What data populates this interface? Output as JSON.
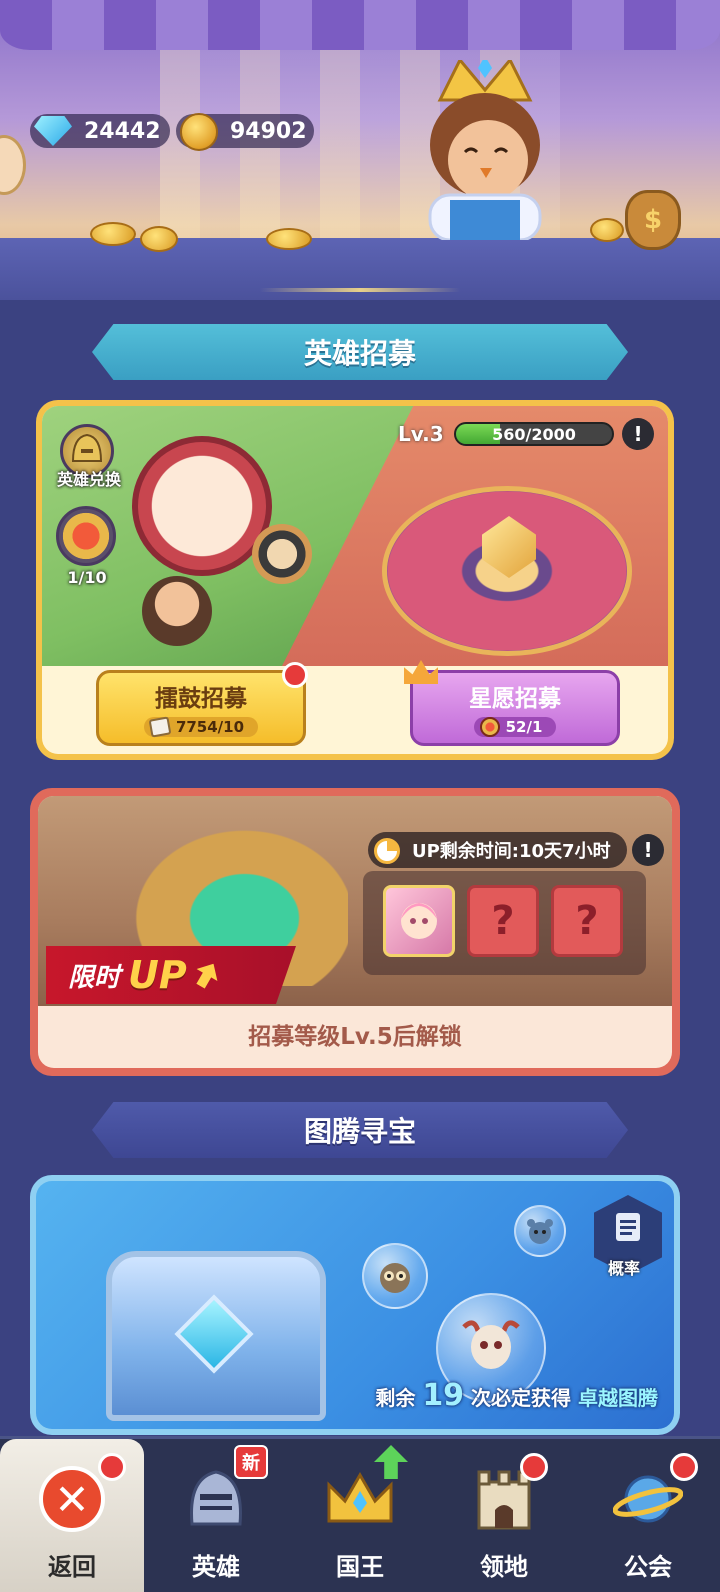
{
  "currency": {
    "gems": "24442",
    "gold": "94902"
  },
  "recruit": {
    "section_title": "英雄招募",
    "hero_exchange_label": "英雄兑换",
    "token_count": "1/10",
    "level_label": "Lv.3",
    "exp_text": "560/2000",
    "exp_progress": 0.28,
    "info_icon": "!",
    "drum_button": {
      "title": "擂鼓招募",
      "cost": "7754/10"
    },
    "star_button": {
      "title": "星愿招募",
      "cost": "52/1"
    }
  },
  "limited_up": {
    "ribbon_prefix": "限时",
    "ribbon_up": "UP",
    "time_label": "UP剩余时间:10天7小时",
    "info_icon": "!",
    "slot_question": "?",
    "unlock_text": "招募等级Lv.5后解锁"
  },
  "totem": {
    "section_title": "图腾寻宝",
    "rate_label": "概率",
    "remain_prefix": "剩余",
    "remain_count": "19",
    "remain_mid": "次必定获得",
    "remain_highlight": "卓越图腾"
  },
  "nav": {
    "back": "返回",
    "hero": "英雄",
    "hero_badge": "新",
    "king": "国王",
    "territory": "领地",
    "guild": "公会",
    "close_glyph": "✕"
  },
  "colors": {
    "background": "#3b4281",
    "accent_red": "#e63a3a",
    "gold": "#f5bd2a",
    "purple": "#c06ad8"
  }
}
